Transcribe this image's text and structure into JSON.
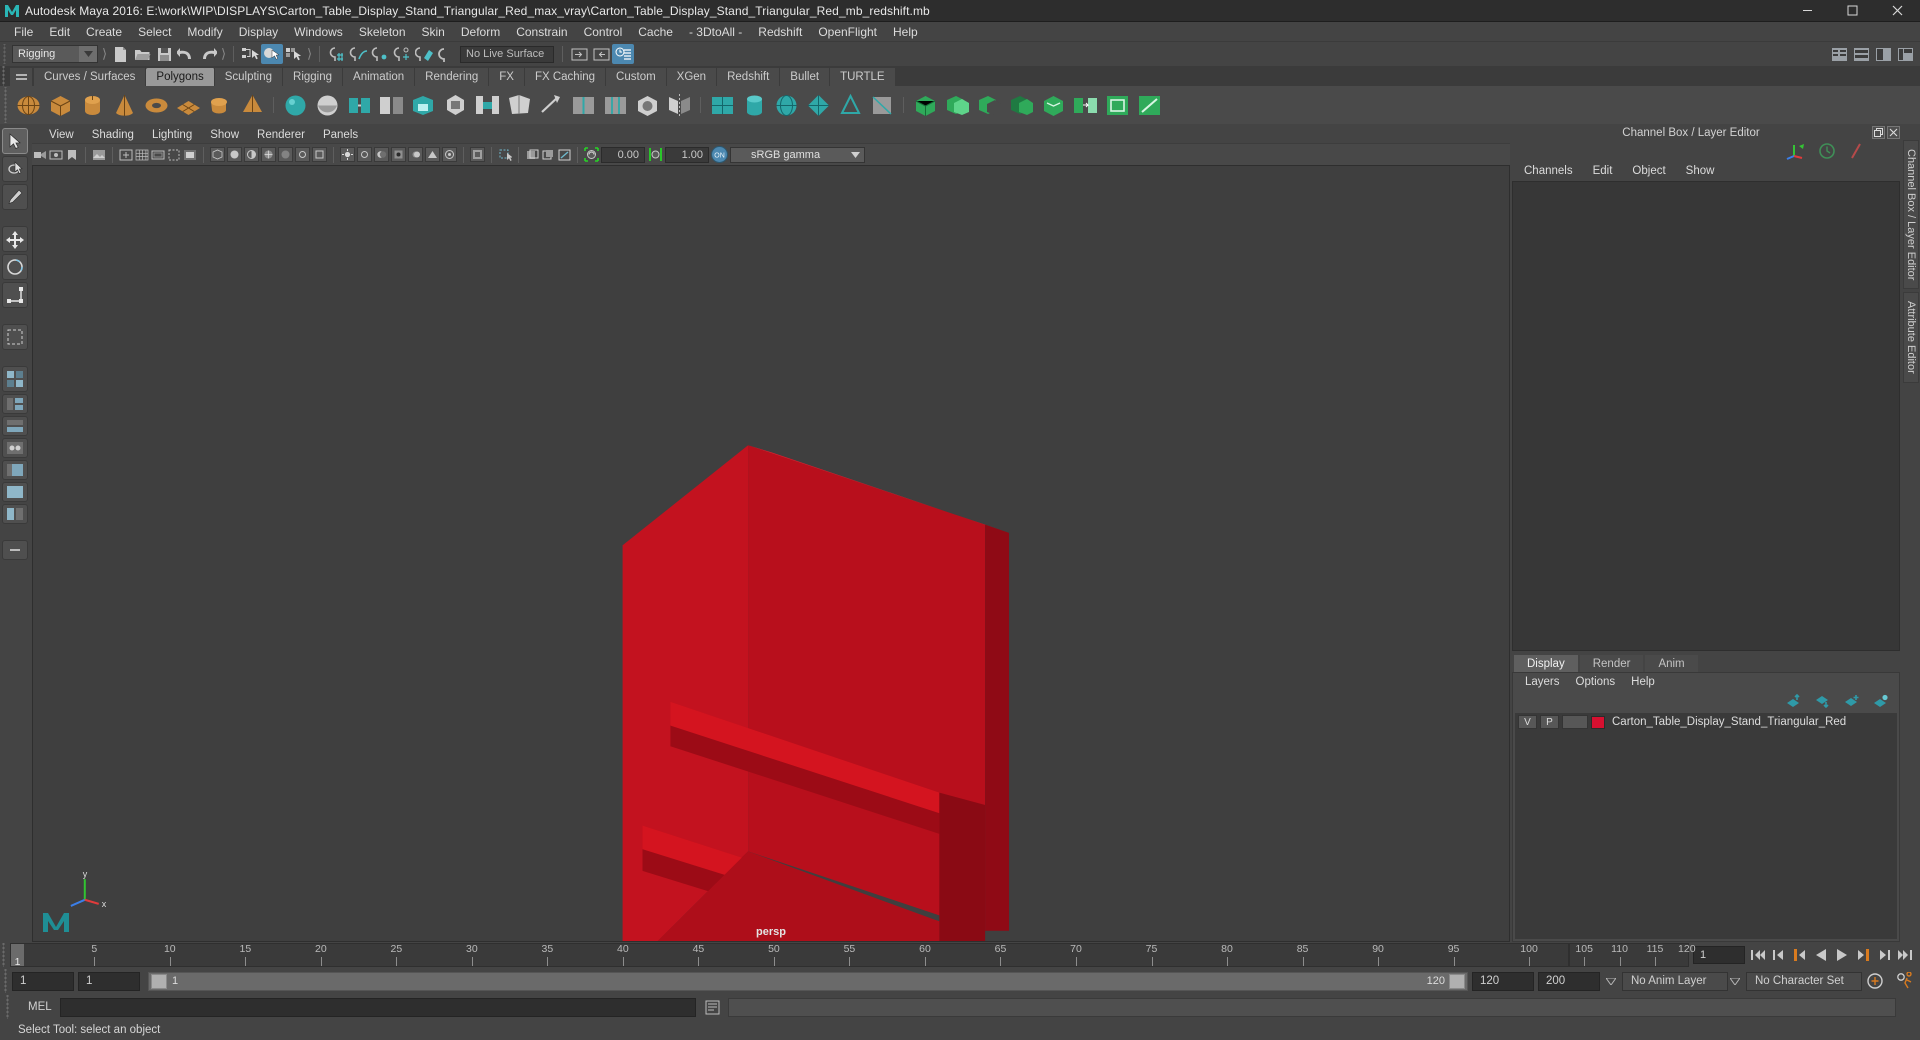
{
  "window": {
    "title": "Autodesk Maya 2016: E:\\work\\WIP\\DISPLAYS\\Carton_Table_Display_Stand_Triangular_Red_max_vray\\Carton_Table_Display_Stand_Triangular_Red_mb_redshift.mb",
    "minimize": "─",
    "maximize": "❐",
    "close": "✕"
  },
  "menubar": {
    "items": [
      {
        "label": "File"
      },
      {
        "label": "Edit"
      },
      {
        "label": "Create"
      },
      {
        "label": "Select"
      },
      {
        "label": "Modify"
      },
      {
        "label": "Display"
      },
      {
        "label": "Windows"
      },
      {
        "label": "Skeleton"
      },
      {
        "label": "Skin"
      },
      {
        "label": "Deform"
      },
      {
        "label": "Constrain"
      },
      {
        "label": "Control"
      },
      {
        "label": "Cache"
      },
      {
        "label": "- 3DtoAll -"
      },
      {
        "label": "Redshift"
      },
      {
        "label": "OpenFlight"
      },
      {
        "label": "Help"
      }
    ]
  },
  "statusbar": {
    "mode": "Rigging",
    "live_surface": "No Live Surface",
    "dropdown_arrow": "▼"
  },
  "shelf": {
    "tabs": [
      {
        "label": "Curves / Surfaces",
        "active": false
      },
      {
        "label": "Polygons",
        "active": true
      },
      {
        "label": "Sculpting",
        "active": false
      },
      {
        "label": "Rigging",
        "active": false
      },
      {
        "label": "Animation",
        "active": false
      },
      {
        "label": "Rendering",
        "active": false
      },
      {
        "label": "FX",
        "active": false
      },
      {
        "label": "FX Caching",
        "active": false
      },
      {
        "label": "Custom",
        "active": false
      },
      {
        "label": "XGen",
        "active": false
      },
      {
        "label": "Redshift",
        "active": false
      },
      {
        "label": "Bullet",
        "active": false
      },
      {
        "label": "TURTLE",
        "active": false
      }
    ]
  },
  "panel": {
    "menus": [
      {
        "label": "View"
      },
      {
        "label": "Shading"
      },
      {
        "label": "Lighting"
      },
      {
        "label": "Show"
      },
      {
        "label": "Renderer"
      },
      {
        "label": "Panels"
      }
    ],
    "exposure": "0.00",
    "gamma": "1.00",
    "view_transform": "sRGB gamma",
    "color_mgmt_toggle": "ON",
    "camera_label": "persp",
    "model_color": "#c3121f",
    "axis_x": "x",
    "axis_y": "y"
  },
  "channelbox": {
    "title": "Channel Box / Layer Editor",
    "restore_glyph": "❐",
    "close_glyph": "✕",
    "tabs": [
      {
        "label": "Channels"
      },
      {
        "label": "Edit"
      },
      {
        "label": "Object"
      },
      {
        "label": "Show"
      }
    ]
  },
  "layereditor": {
    "tabs": [
      {
        "label": "Display",
        "active": true
      },
      {
        "label": "Render",
        "active": false
      },
      {
        "label": "Anim",
        "active": false
      }
    ],
    "menus": [
      {
        "label": "Layers"
      },
      {
        "label": "Options"
      },
      {
        "label": "Help"
      }
    ],
    "rows": [
      {
        "visibility": "V",
        "playback": "P",
        "state": "",
        "color": "#d61030",
        "name": "Carton_Table_Display_Stand_Triangular_Red"
      }
    ]
  },
  "vertical_tabs": [
    {
      "label": "Channel Box / Layer Editor"
    },
    {
      "label": "Attribute Editor"
    }
  ],
  "timeline": {
    "current_frame": "1",
    "current_frame_field": "1",
    "end_label": "120",
    "tick_labels": [
      "5",
      "10",
      "15",
      "20",
      "25",
      "30",
      "35",
      "40",
      "45",
      "50",
      "55",
      "60",
      "65",
      "70",
      "75",
      "80",
      "85",
      "90",
      "95",
      "100",
      "105",
      "110",
      "115",
      "120"
    ],
    "play_buttons": [
      {
        "name": "go-to-start"
      },
      {
        "name": "step-back-keyframe"
      },
      {
        "name": "step-back-frame"
      },
      {
        "name": "play-backwards"
      },
      {
        "name": "play-forwards"
      },
      {
        "name": "step-forward-frame"
      },
      {
        "name": "step-forward-keyframe"
      },
      {
        "name": "go-to-end"
      }
    ]
  },
  "rangeslider": {
    "anim_start": "1",
    "range_start": "1",
    "slider_start_label": "1",
    "slider_end_label": "120",
    "range_end": "120",
    "anim_end": "200",
    "anim_layer": "No Anim Layer",
    "character_set": "No Character Set",
    "caret": "▽"
  },
  "mel": {
    "label": "MEL",
    "command": "",
    "output": ""
  },
  "helpline": {
    "text": "Select Tool: select an object"
  }
}
